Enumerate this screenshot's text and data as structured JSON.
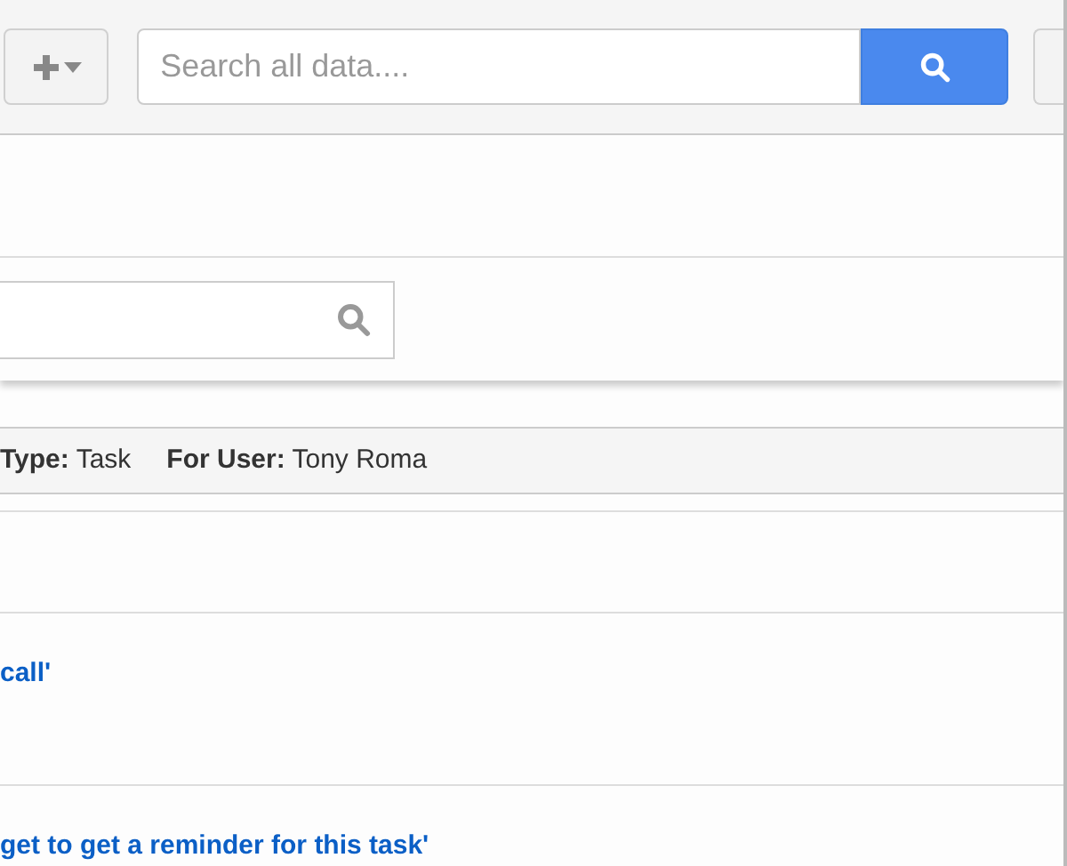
{
  "toolbar": {
    "search": {
      "placeholder": "Search all data...."
    }
  },
  "filter_bar": [
    {
      "label": "Type:",
      "value": "Task"
    },
    {
      "label": "For User:",
      "value": "Tony Roma"
    }
  ],
  "rows": [
    {
      "title": "call'"
    },
    {
      "title": "get to get a reminder for this task'"
    }
  ]
}
